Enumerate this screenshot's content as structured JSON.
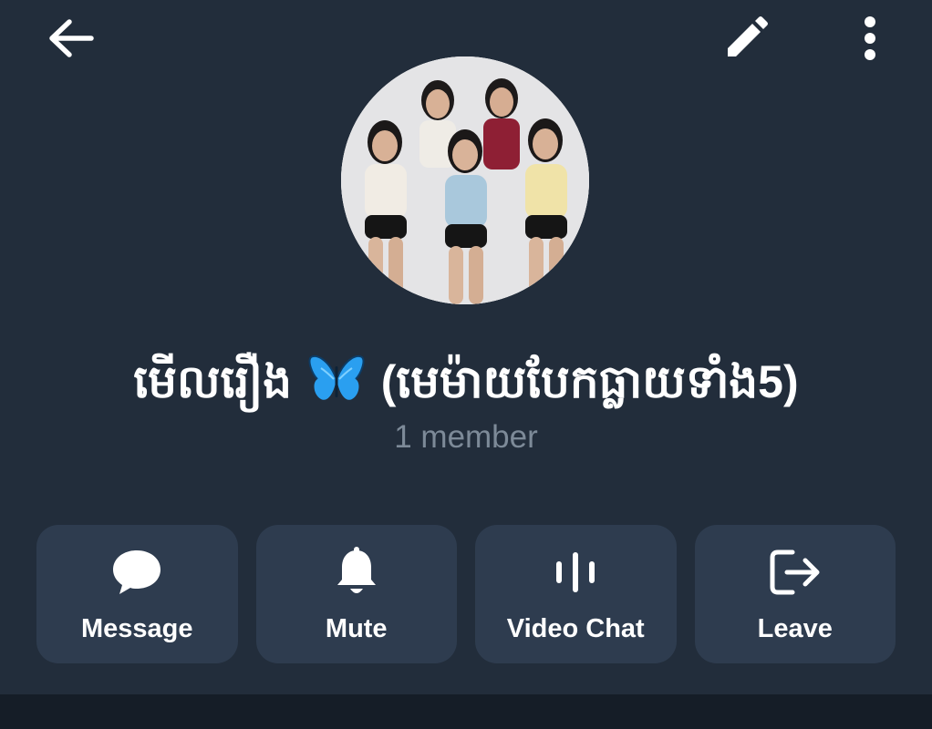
{
  "header": {
    "back_icon": "arrow-left-icon",
    "edit_icon": "pencil-icon",
    "more_icon": "more-vertical-icon"
  },
  "profile": {
    "name_part1": "មើលរឿង",
    "emoji": "butterfly-icon",
    "name_part2": "(មេម៉ាយបែកធ្លាយទាំង5)",
    "subtitle": "1 member"
  },
  "actions": [
    {
      "label": "Message",
      "icon": "chat-bubble-icon"
    },
    {
      "label": "Mute",
      "icon": "bell-icon"
    },
    {
      "label": "Video Chat",
      "icon": "voice-chat-icon"
    },
    {
      "label": "Leave",
      "icon": "leave-icon"
    }
  ],
  "colors": {
    "background": "#222d3b",
    "button_bg": "#2e3c4f",
    "subtitle": "#7d8a98",
    "bottom_strip": "#151d27"
  }
}
